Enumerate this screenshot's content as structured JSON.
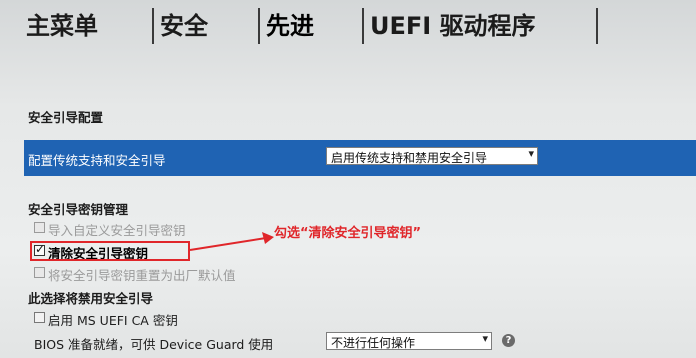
{
  "tabs": [
    {
      "label": "主菜单"
    },
    {
      "label": "安全"
    },
    {
      "label": "先进"
    },
    {
      "label": "UEFI 驱动程序"
    }
  ],
  "secure_boot_config": {
    "heading": "安全引导配置",
    "legacy_row": {
      "label": "配置传统支持和安全引导",
      "value": "启用传统支持和禁用安全引导"
    }
  },
  "key_management": {
    "heading": "安全引导密钥管理",
    "import_keys": {
      "label": "导入自定义安全引导密钥",
      "checked": false,
      "enabled": false
    },
    "clear_keys": {
      "label": "清除安全引导密钥",
      "checked": true,
      "enabled": true
    },
    "reset_keys": {
      "label": "将安全引导密钥重置为出厂默认值",
      "checked": false,
      "enabled": false
    }
  },
  "disable_section": {
    "heading": "此选择将禁用安全引导",
    "ms_ca": {
      "label": "启用 MS UEFI CA 密钥",
      "checked": false,
      "enabled": true
    }
  },
  "device_guard": {
    "label": "BIOS 准备就绪，可供 Device Guard 使用",
    "value": "不进行任何操作",
    "help_glyph": "?"
  },
  "annotation": {
    "text": "勾选“清除安全引导密钥”",
    "color": "#e0262a"
  },
  "colors": {
    "highlight": "#1f63b3",
    "annotation_red": "#e0262a"
  }
}
